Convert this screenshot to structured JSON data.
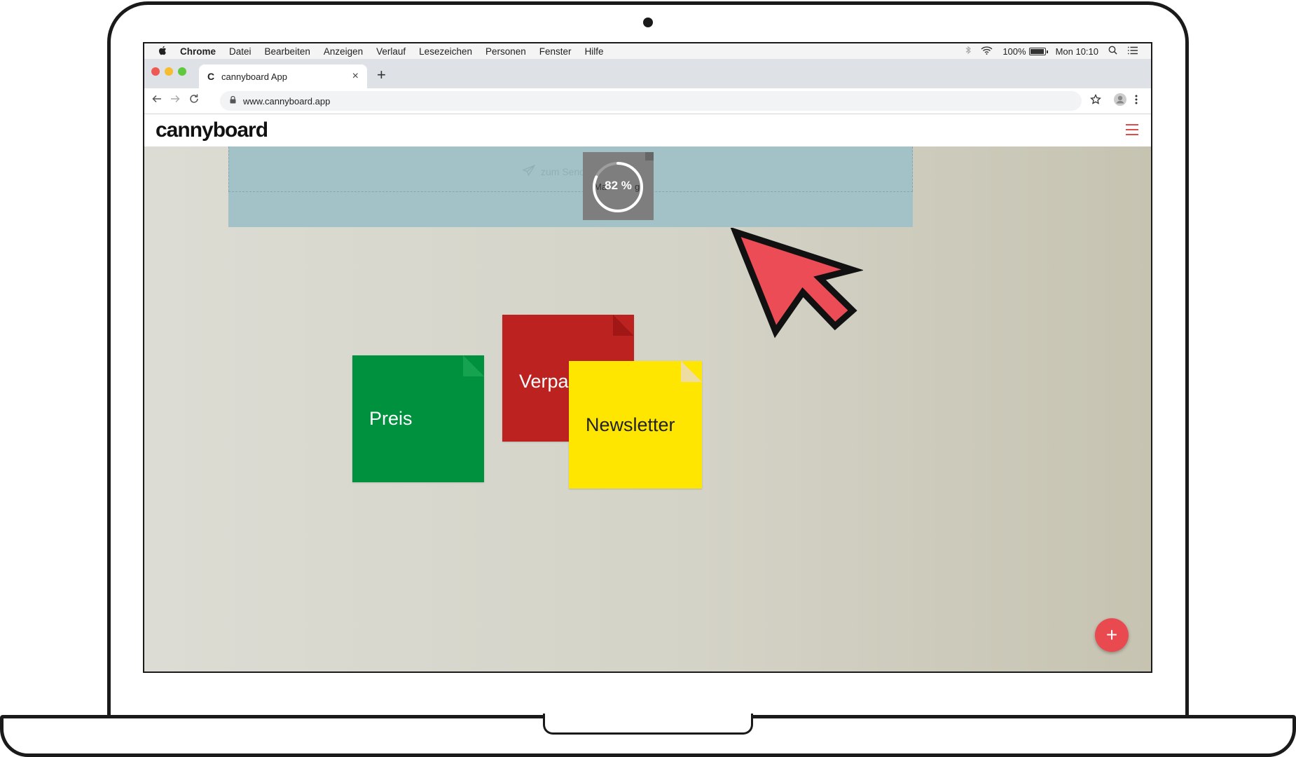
{
  "menubar": {
    "apple": "",
    "items": [
      "Chrome",
      "Datei",
      "Bearbeiten",
      "Anzeigen",
      "Verlauf",
      "Lesezeichen",
      "Personen",
      "Fenster",
      "Hilfe"
    ],
    "battery": "100%",
    "clock": "Mon 10:10"
  },
  "browser": {
    "tab_title": "cannyboard App",
    "tab_favicon": "C",
    "new_tab": "+",
    "close_tab": "×",
    "url": "www.cannyboard.app"
  },
  "app": {
    "logo": "cannyboard",
    "dropzone_label": "zum Send",
    "progress_under": "Ma",
    "progress_suffix": "g",
    "progress_percent": "82 %",
    "progress_value": 82,
    "fab": "+",
    "accent": "#e84a50"
  },
  "notes": [
    {
      "label": "Preis",
      "color": "#00913f",
      "fold": "#16a34f",
      "text_color": "#ffffff"
    },
    {
      "label": "Verpac",
      "color": "#bb2220",
      "fold": "#a01715",
      "text_color": "#ffffff"
    },
    {
      "label": "Newsletter",
      "color": "#ffe600",
      "fold": "#efdca0",
      "text_color": "#222222"
    }
  ]
}
